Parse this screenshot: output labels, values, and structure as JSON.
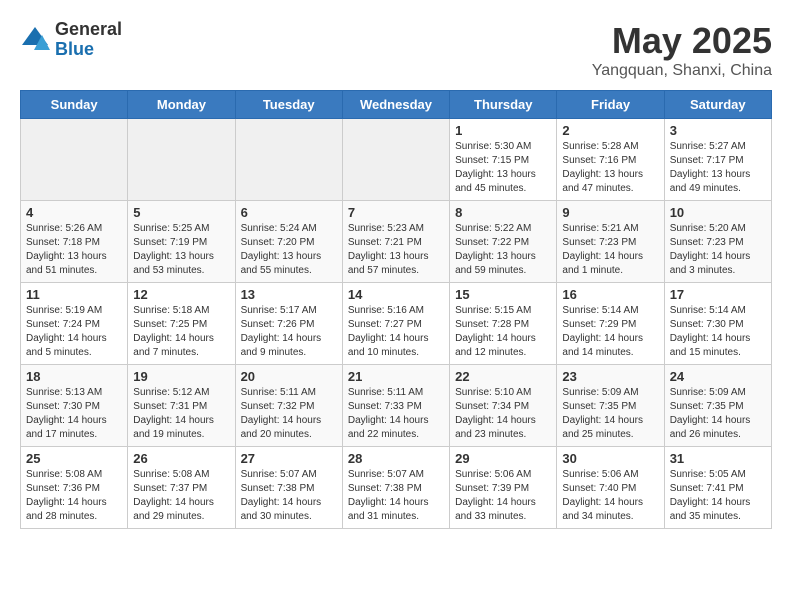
{
  "logo": {
    "general": "General",
    "blue": "Blue"
  },
  "title": "May 2025",
  "location": "Yangquan, Shanxi, China",
  "weekdays": [
    "Sunday",
    "Monday",
    "Tuesday",
    "Wednesday",
    "Thursday",
    "Friday",
    "Saturday"
  ],
  "weeks": [
    [
      {
        "day": "",
        "empty": true
      },
      {
        "day": "",
        "empty": true
      },
      {
        "day": "",
        "empty": true
      },
      {
        "day": "",
        "empty": true
      },
      {
        "day": "1",
        "sunrise": "Sunrise: 5:30 AM",
        "sunset": "Sunset: 7:15 PM",
        "daylight": "Daylight: 13 hours and 45 minutes."
      },
      {
        "day": "2",
        "sunrise": "Sunrise: 5:28 AM",
        "sunset": "Sunset: 7:16 PM",
        "daylight": "Daylight: 13 hours and 47 minutes."
      },
      {
        "day": "3",
        "sunrise": "Sunrise: 5:27 AM",
        "sunset": "Sunset: 7:17 PM",
        "daylight": "Daylight: 13 hours and 49 minutes."
      }
    ],
    [
      {
        "day": "4",
        "sunrise": "Sunrise: 5:26 AM",
        "sunset": "Sunset: 7:18 PM",
        "daylight": "Daylight: 13 hours and 51 minutes."
      },
      {
        "day": "5",
        "sunrise": "Sunrise: 5:25 AM",
        "sunset": "Sunset: 7:19 PM",
        "daylight": "Daylight: 13 hours and 53 minutes."
      },
      {
        "day": "6",
        "sunrise": "Sunrise: 5:24 AM",
        "sunset": "Sunset: 7:20 PM",
        "daylight": "Daylight: 13 hours and 55 minutes."
      },
      {
        "day": "7",
        "sunrise": "Sunrise: 5:23 AM",
        "sunset": "Sunset: 7:21 PM",
        "daylight": "Daylight: 13 hours and 57 minutes."
      },
      {
        "day": "8",
        "sunrise": "Sunrise: 5:22 AM",
        "sunset": "Sunset: 7:22 PM",
        "daylight": "Daylight: 13 hours and 59 minutes."
      },
      {
        "day": "9",
        "sunrise": "Sunrise: 5:21 AM",
        "sunset": "Sunset: 7:23 PM",
        "daylight": "Daylight: 14 hours and 1 minute."
      },
      {
        "day": "10",
        "sunrise": "Sunrise: 5:20 AM",
        "sunset": "Sunset: 7:23 PM",
        "daylight": "Daylight: 14 hours and 3 minutes."
      }
    ],
    [
      {
        "day": "11",
        "sunrise": "Sunrise: 5:19 AM",
        "sunset": "Sunset: 7:24 PM",
        "daylight": "Daylight: 14 hours and 5 minutes."
      },
      {
        "day": "12",
        "sunrise": "Sunrise: 5:18 AM",
        "sunset": "Sunset: 7:25 PM",
        "daylight": "Daylight: 14 hours and 7 minutes."
      },
      {
        "day": "13",
        "sunrise": "Sunrise: 5:17 AM",
        "sunset": "Sunset: 7:26 PM",
        "daylight": "Daylight: 14 hours and 9 minutes."
      },
      {
        "day": "14",
        "sunrise": "Sunrise: 5:16 AM",
        "sunset": "Sunset: 7:27 PM",
        "daylight": "Daylight: 14 hours and 10 minutes."
      },
      {
        "day": "15",
        "sunrise": "Sunrise: 5:15 AM",
        "sunset": "Sunset: 7:28 PM",
        "daylight": "Daylight: 14 hours and 12 minutes."
      },
      {
        "day": "16",
        "sunrise": "Sunrise: 5:14 AM",
        "sunset": "Sunset: 7:29 PM",
        "daylight": "Daylight: 14 hours and 14 minutes."
      },
      {
        "day": "17",
        "sunrise": "Sunrise: 5:14 AM",
        "sunset": "Sunset: 7:30 PM",
        "daylight": "Daylight: 14 hours and 15 minutes."
      }
    ],
    [
      {
        "day": "18",
        "sunrise": "Sunrise: 5:13 AM",
        "sunset": "Sunset: 7:30 PM",
        "daylight": "Daylight: 14 hours and 17 minutes."
      },
      {
        "day": "19",
        "sunrise": "Sunrise: 5:12 AM",
        "sunset": "Sunset: 7:31 PM",
        "daylight": "Daylight: 14 hours and 19 minutes."
      },
      {
        "day": "20",
        "sunrise": "Sunrise: 5:11 AM",
        "sunset": "Sunset: 7:32 PM",
        "daylight": "Daylight: 14 hours and 20 minutes."
      },
      {
        "day": "21",
        "sunrise": "Sunrise: 5:11 AM",
        "sunset": "Sunset: 7:33 PM",
        "daylight": "Daylight: 14 hours and 22 minutes."
      },
      {
        "day": "22",
        "sunrise": "Sunrise: 5:10 AM",
        "sunset": "Sunset: 7:34 PM",
        "daylight": "Daylight: 14 hours and 23 minutes."
      },
      {
        "day": "23",
        "sunrise": "Sunrise: 5:09 AM",
        "sunset": "Sunset: 7:35 PM",
        "daylight": "Daylight: 14 hours and 25 minutes."
      },
      {
        "day": "24",
        "sunrise": "Sunrise: 5:09 AM",
        "sunset": "Sunset: 7:35 PM",
        "daylight": "Daylight: 14 hours and 26 minutes."
      }
    ],
    [
      {
        "day": "25",
        "sunrise": "Sunrise: 5:08 AM",
        "sunset": "Sunset: 7:36 PM",
        "daylight": "Daylight: 14 hours and 28 minutes."
      },
      {
        "day": "26",
        "sunrise": "Sunrise: 5:08 AM",
        "sunset": "Sunset: 7:37 PM",
        "daylight": "Daylight: 14 hours and 29 minutes."
      },
      {
        "day": "27",
        "sunrise": "Sunrise: 5:07 AM",
        "sunset": "Sunset: 7:38 PM",
        "daylight": "Daylight: 14 hours and 30 minutes."
      },
      {
        "day": "28",
        "sunrise": "Sunrise: 5:07 AM",
        "sunset": "Sunset: 7:38 PM",
        "daylight": "Daylight: 14 hours and 31 minutes."
      },
      {
        "day": "29",
        "sunrise": "Sunrise: 5:06 AM",
        "sunset": "Sunset: 7:39 PM",
        "daylight": "Daylight: 14 hours and 33 minutes."
      },
      {
        "day": "30",
        "sunrise": "Sunrise: 5:06 AM",
        "sunset": "Sunset: 7:40 PM",
        "daylight": "Daylight: 14 hours and 34 minutes."
      },
      {
        "day": "31",
        "sunrise": "Sunrise: 5:05 AM",
        "sunset": "Sunset: 7:41 PM",
        "daylight": "Daylight: 14 hours and 35 minutes."
      }
    ]
  ]
}
